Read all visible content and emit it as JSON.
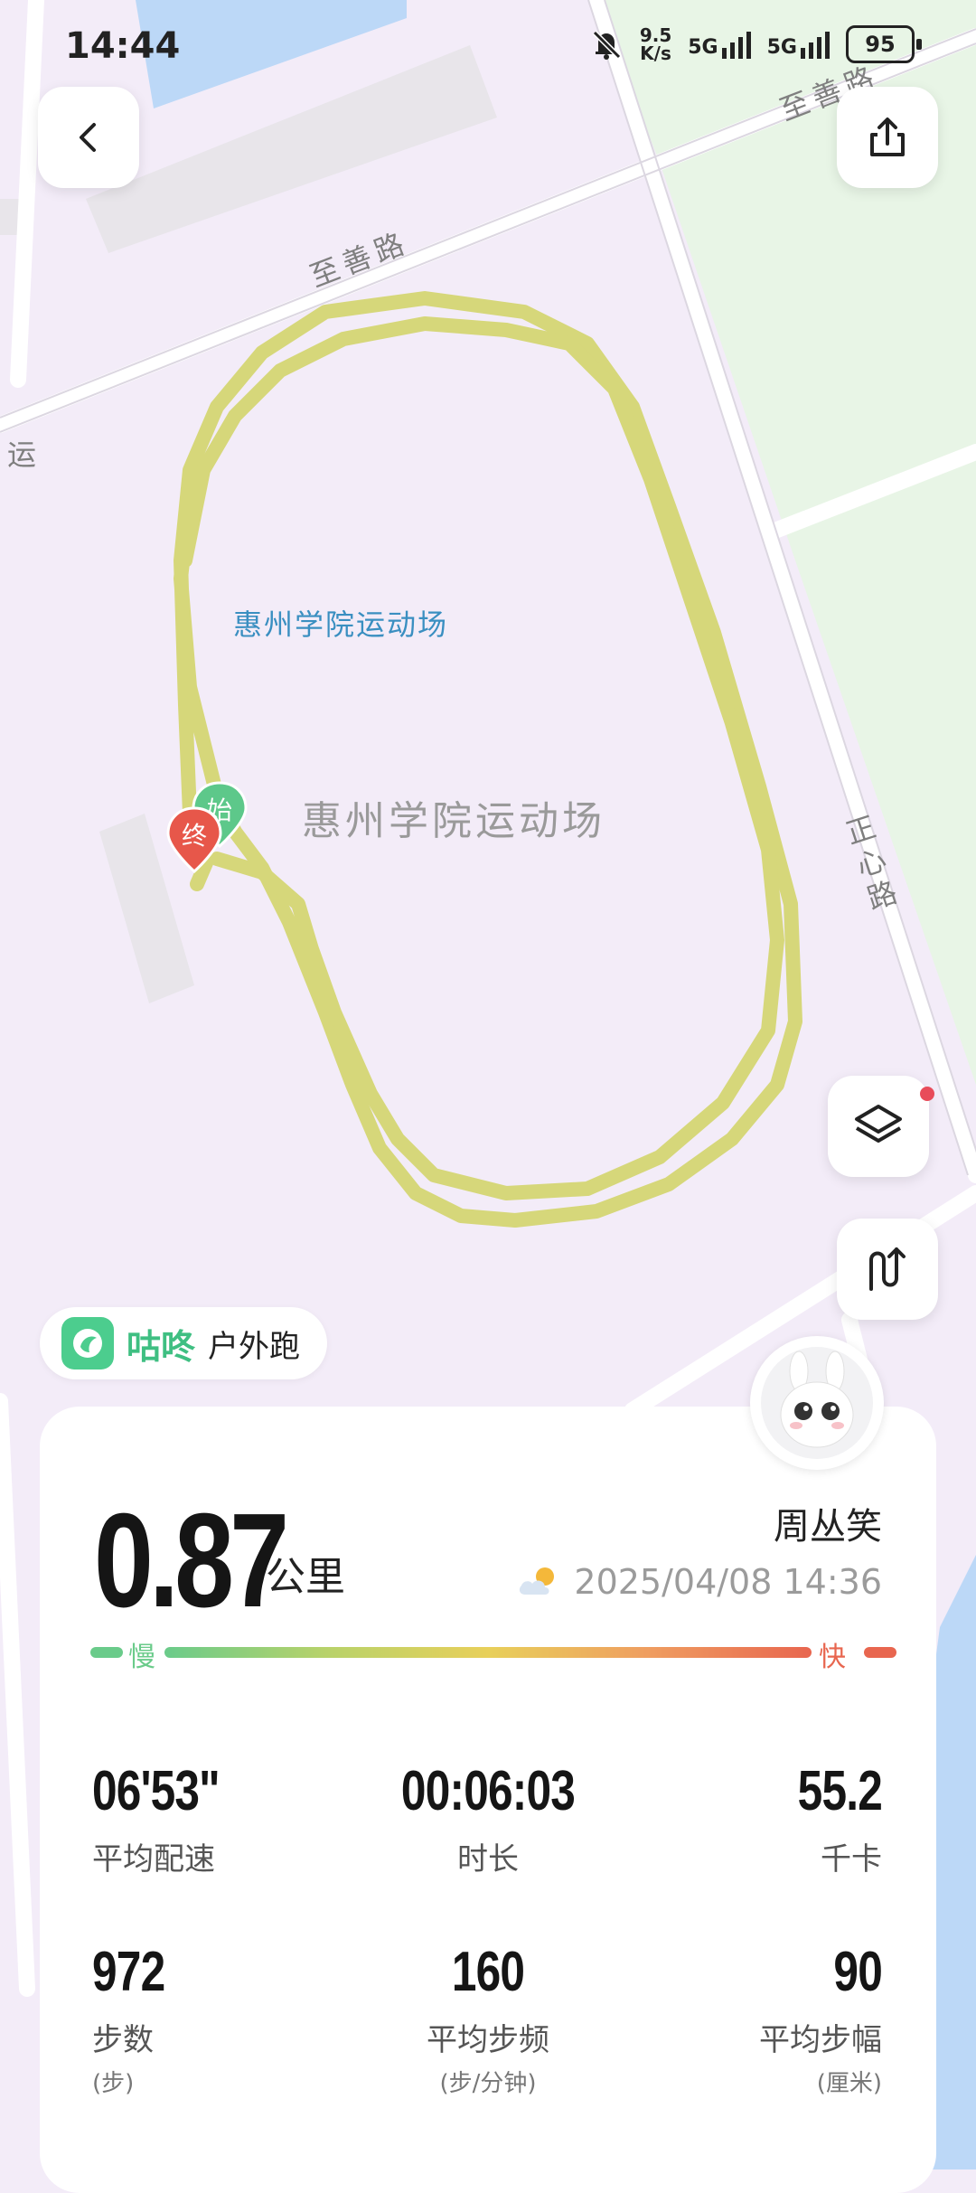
{
  "status_bar": {
    "time": "14:44",
    "net_speed_value": "9.5",
    "net_speed_unit": "K/s",
    "signal1": "5G",
    "signal2": "5G",
    "battery": "95"
  },
  "map": {
    "road_top": "至善路",
    "road_top_right": "至善路",
    "road_right": "正心路",
    "road_left_partial": "运",
    "poi_small": "惠州学院运动场",
    "poi_big": "惠州学院运动场",
    "marker_start": "始",
    "marker_end": "终",
    "track_color": "#d6d77a"
  },
  "brand": {
    "name": "咕咚",
    "activity": "户外跑"
  },
  "summary": {
    "distance": "0.87",
    "distance_unit": "公里",
    "user_name": "周丛笑",
    "datetime": "2025/04/08 14:36",
    "weather_icon": "partly-cloudy-icon",
    "pace_slow": "慢",
    "pace_fast": "快"
  },
  "stats": [
    {
      "value": "06'53\"",
      "label": "平均配速",
      "sub": ""
    },
    {
      "value": "00:06:03",
      "label": "时长",
      "sub": ""
    },
    {
      "value": "55.2",
      "label": "千卡",
      "sub": ""
    },
    {
      "value": "972",
      "label": "步数",
      "sub": "(步)"
    },
    {
      "value": "160",
      "label": "平均步频",
      "sub": "(步/分钟)"
    },
    {
      "value": "90",
      "label": "平均步幅",
      "sub": "(厘米)"
    }
  ],
  "colors": {
    "brand_green": "#3fbf82",
    "slow_green": "#6acb8a",
    "fast_red": "#e8664f",
    "end_marker": "#e7574a",
    "start_marker": "#5dc88a"
  }
}
